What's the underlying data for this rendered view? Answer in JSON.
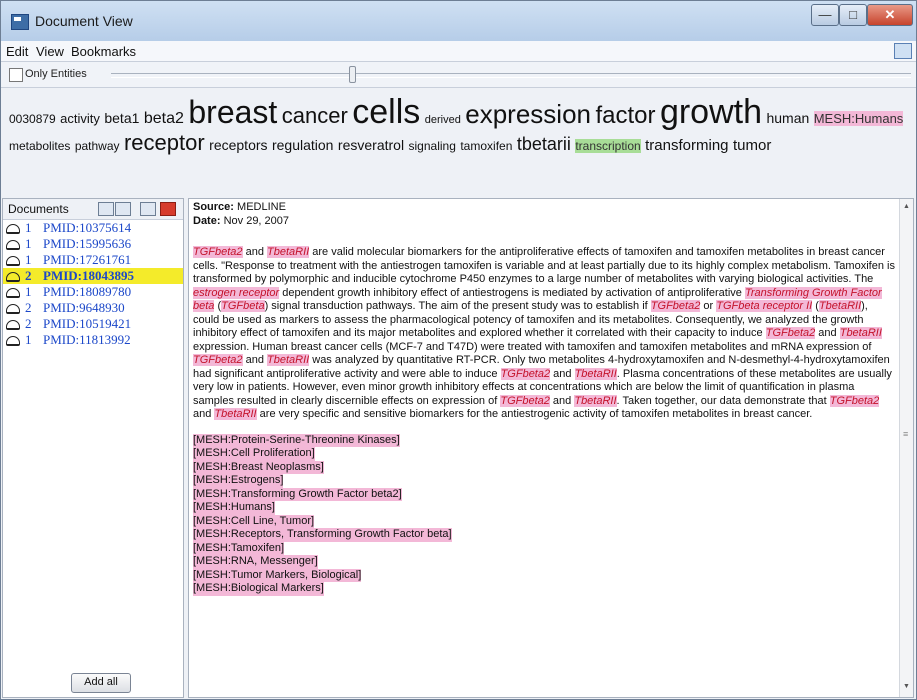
{
  "window": {
    "title": "Document View"
  },
  "menu": {
    "items": [
      "Edit",
      "View",
      "Bookmarks"
    ]
  },
  "filter": {
    "only_entities_label": "Only Entities",
    "only_entities_checked": false
  },
  "cloud": [
    {
      "text": "0030879",
      "size": 12
    },
    {
      "text": "activity",
      "size": 13
    },
    {
      "text": "beta1",
      "size": 14
    },
    {
      "text": "beta2",
      "size": 16
    },
    {
      "text": "breast",
      "size": 32
    },
    {
      "text": "cancer",
      "size": 22
    },
    {
      "text": "cells",
      "size": 34
    },
    {
      "text": "derived",
      "size": 11
    },
    {
      "text": "expression",
      "size": 26
    },
    {
      "text": "factor",
      "size": 24
    },
    {
      "text": "growth",
      "size": 34
    },
    {
      "text": "human",
      "size": 14
    },
    {
      "text": "MESH:Humans",
      "size": 13,
      "highlight": "mesh"
    },
    {
      "text": "metabolites",
      "size": 12
    },
    {
      "text": "pathway",
      "size": 12
    },
    {
      "text": "receptor",
      "size": 22
    },
    {
      "text": "receptors",
      "size": 14
    },
    {
      "text": "regulation",
      "size": 14
    },
    {
      "text": "resveratrol",
      "size": 14
    },
    {
      "text": "signaling",
      "size": 12
    },
    {
      "text": "tamoxifen",
      "size": 12
    },
    {
      "text": "tbetarii",
      "size": 18
    },
    {
      "text": "transcription",
      "size": 12,
      "highlight": "green"
    },
    {
      "text": "transforming",
      "size": 15
    },
    {
      "text": "tumor",
      "size": 15
    }
  ],
  "documents": {
    "header_label": "Documents",
    "items": [
      {
        "count": "1",
        "id": "PMID:10375614",
        "selected": false
      },
      {
        "count": "1",
        "id": "PMID:15995636",
        "selected": false
      },
      {
        "count": "1",
        "id": "PMID:17261761",
        "selected": false
      },
      {
        "count": "2",
        "id": "PMID:18043895",
        "selected": true
      },
      {
        "count": "1",
        "id": "PMID:18089780",
        "selected": false
      },
      {
        "count": "2",
        "id": "PMID:9648930",
        "selected": false
      },
      {
        "count": "2",
        "id": "PMID:10519421",
        "selected": false
      },
      {
        "count": "1",
        "id": "PMID:11813992",
        "selected": false
      }
    ],
    "add_all_label": "Add all"
  },
  "detail": {
    "source_label": "Source:",
    "source_value": "MEDLINE",
    "date_label": "Date:",
    "date_value": "Nov 29, 2007",
    "abstract": [
      {
        "t": "TGFbeta2",
        "h": true
      },
      {
        "t": " and "
      },
      {
        "t": "TbetaRII",
        "h": true
      },
      {
        "t": " are valid molecular biomarkers for the antiproliferative effects of tamoxifen and tamoxifen metabolites in breast cancer cells. \"Response to treatment with the antiestrogen tamoxifen is variable and at least partially due to its highly complex metabolism. Tamoxifen is transformed by polymorphic and inducible cytochrome P450 enzymes to a large number of metabolites with varying biological activities. The "
      },
      {
        "t": "estrogen receptor",
        "h": true
      },
      {
        "t": " dependent growth inhibitory effect of antiestrogens is mediated by activation of antiproliferative "
      },
      {
        "t": "Transforming Growth Factor beta",
        "h": true
      },
      {
        "t": " ("
      },
      {
        "t": "TGFbeta",
        "h": true
      },
      {
        "t": ") signal transduction pathways. The aim of the present study was to establish if "
      },
      {
        "t": "TGFbeta2",
        "h": true
      },
      {
        "t": " or "
      },
      {
        "t": "TGFbeta receptor II",
        "h": true
      },
      {
        "t": " ("
      },
      {
        "t": "TbetaRII",
        "h": true
      },
      {
        "t": "), could be used as markers to assess the pharmacological potency of tamoxifen and its metabolites. Consequently, we analyzed the growth inhibitory effect of tamoxifen and its major metabolites and explored whether it correlated with their capacity to induce "
      },
      {
        "t": "TGFbeta2",
        "h": true
      },
      {
        "t": " and "
      },
      {
        "t": "TbetaRII",
        "h": true
      },
      {
        "t": " expression. Human breast cancer cells (MCF-7 and T47D) were treated with tamoxifen and tamoxifen metabolites and mRNA expression of "
      },
      {
        "t": "TGFbeta2",
        "h": true
      },
      {
        "t": " and "
      },
      {
        "t": "TbetaRII",
        "h": true
      },
      {
        "t": " was analyzed by quantitative RT-PCR. Only two metabolites 4-hydroxytamoxifen and N-desmethyl-4-hydroxytamoxifen had significant antiproliferative activity and were able to induce "
      },
      {
        "t": "TGFbeta2",
        "h": true
      },
      {
        "t": " and "
      },
      {
        "t": "TbetaRII",
        "h": true
      },
      {
        "t": ". Plasma concentrations of these metabolites are usually very low in patients. However, even minor growth inhibitory effects at concentrations which are below the limit of quantification in plasma samples resulted in clearly discernible effects on expression of "
      },
      {
        "t": "TGFbeta2",
        "h": true
      },
      {
        "t": " and "
      },
      {
        "t": "TbetaRII",
        "h": true
      },
      {
        "t": ". Taken together, our data demonstrate that "
      },
      {
        "t": "TGFbeta2",
        "h": true
      },
      {
        "t": " and "
      },
      {
        "t": "TbetaRII",
        "h": true
      },
      {
        "t": " are very specific and sensitive biomarkers for the antiestrogenic activity of tamoxifen metabolites in breast cancer."
      }
    ],
    "mesh_terms": [
      "[MESH:Protein-Serine-Threonine Kinases]",
      "[MESH:Cell Proliferation]",
      "[MESH:Breast Neoplasms]",
      "[MESH:Estrogens]",
      "[MESH:Transforming Growth Factor beta2]",
      "[MESH:Humans]",
      "[MESH:Cell Line, Tumor]",
      "[MESH:Receptors, Transforming Growth Factor beta]",
      "[MESH:Tamoxifen]",
      "[MESH:RNA, Messenger]",
      "[MESH:Tumor Markers, Biological]",
      "[MESH:Biological Markers]"
    ]
  }
}
